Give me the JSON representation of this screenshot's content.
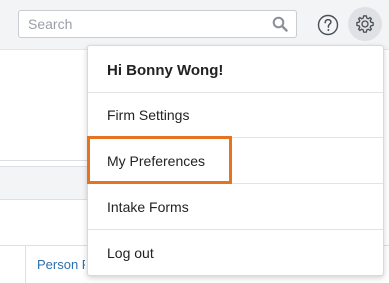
{
  "search": {
    "placeholder": "Search",
    "value": ""
  },
  "header_icons": {
    "search_icon": "magnifier",
    "help_icon": "question-circle",
    "settings_icon": "gear"
  },
  "background": {
    "table_column_label": "Person Re"
  },
  "menu": {
    "greeting": "Hi Bonny Wong!",
    "items": [
      {
        "label": "Firm Settings"
      },
      {
        "label": "My Preferences",
        "highlighted": true
      },
      {
        "label": "Intake Forms"
      },
      {
        "label": "Log out"
      }
    ]
  },
  "colors": {
    "highlight_outline": "#e5731f",
    "link_text": "#2f6fad"
  }
}
